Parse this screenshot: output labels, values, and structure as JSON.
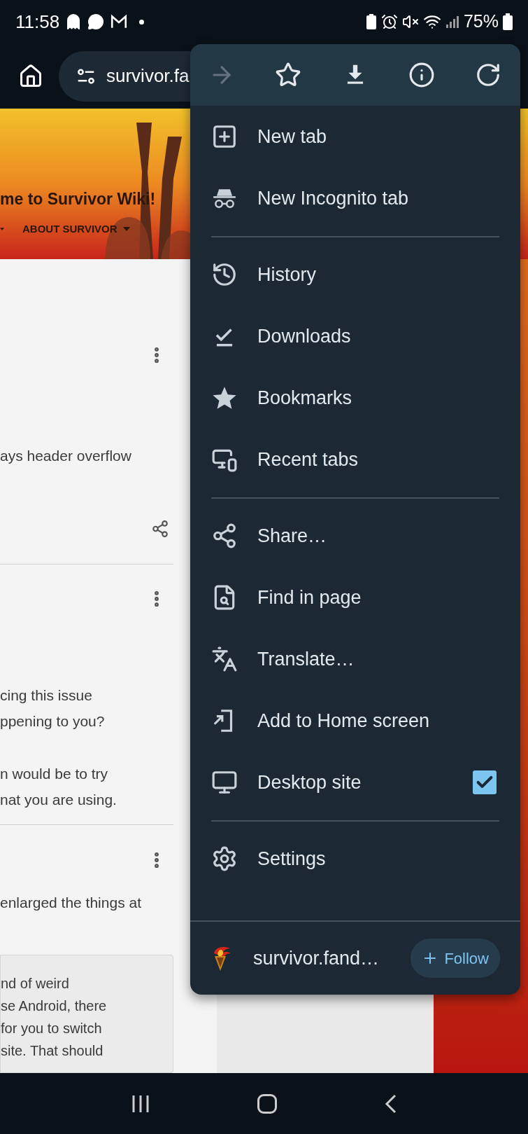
{
  "status_bar": {
    "time": "11:58",
    "battery": "75%"
  },
  "address_bar": {
    "url": "survivor.fa"
  },
  "page": {
    "banner": {
      "title": "me to Survivor Wiki!",
      "nav_items": [
        "ABOUT SURVIVOR"
      ]
    },
    "posts": [
      {
        "paragraphs": [
          [
            "ays header overflow"
          ]
        ]
      },
      {
        "paragraphs": [
          [
            "cing this issue",
            "ppening to you?"
          ],
          [
            "n would be to try",
            "nat you are using."
          ]
        ]
      },
      {
        "paragraphs": [
          [
            "enlarged the things at"
          ]
        ],
        "quote": [
          "nd of weird",
          "se Android, there",
          "for you to switch",
          "site. That should"
        ]
      }
    ]
  },
  "menu": {
    "toolbar": [
      {
        "kind": "forward",
        "disabled": true
      },
      {
        "kind": "bookmark",
        "disabled": false
      },
      {
        "kind": "download",
        "disabled": false
      },
      {
        "kind": "info",
        "disabled": false
      },
      {
        "kind": "reload",
        "disabled": false
      }
    ],
    "sections": [
      [
        {
          "kind": "action",
          "label": "New tab"
        },
        {
          "kind": "action",
          "label": "New Incognito tab"
        }
      ],
      [
        {
          "kind": "action",
          "label": "History"
        },
        {
          "kind": "action",
          "label": "Downloads"
        },
        {
          "kind": "action",
          "label": "Bookmarks"
        },
        {
          "kind": "action",
          "label": "Recent tabs"
        }
      ],
      [
        {
          "kind": "action",
          "label": "Share…"
        },
        {
          "kind": "action",
          "label": "Find in page"
        },
        {
          "kind": "action",
          "label": "Translate…"
        },
        {
          "kind": "action",
          "label": "Add to Home screen"
        },
        {
          "kind": "checkbox",
          "label": "Desktop site",
          "checked": true
        }
      ],
      [
        {
          "kind": "action",
          "label": "Settings"
        }
      ]
    ],
    "footer": {
      "site": "survivor.fand…",
      "follow": "Follow"
    }
  }
}
